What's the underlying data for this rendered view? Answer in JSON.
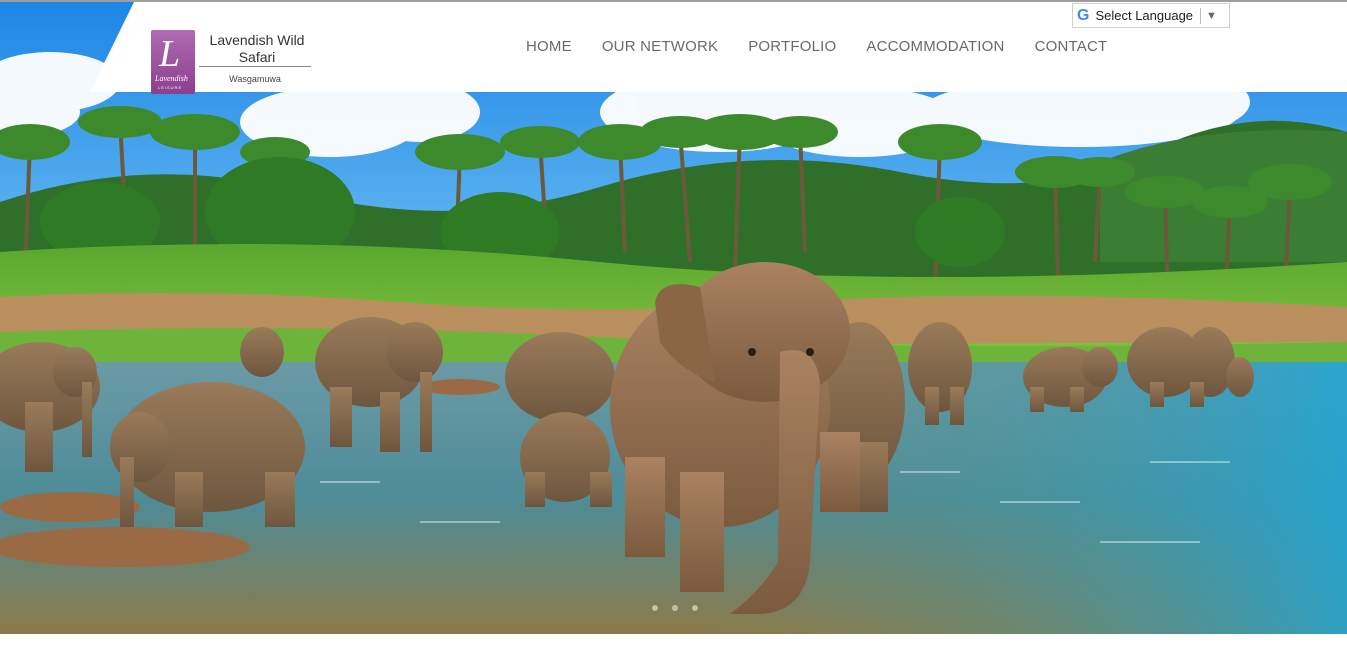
{
  "brand": {
    "name": "Lavendish Wild Safari",
    "location": "Wasgamuwa",
    "logo_letter": "L",
    "logo_line1": "Lavendish",
    "logo_line2": "LEISURE"
  },
  "nav": {
    "items": [
      {
        "label": "HOME"
      },
      {
        "label": "OUR NETWORK"
      },
      {
        "label": "PORTFOLIO"
      },
      {
        "label": "ACCOMMODATION"
      },
      {
        "label": "CONTACT"
      }
    ]
  },
  "translate": {
    "label": "Select Language",
    "arrow": "▼",
    "icon": "G"
  },
  "hero": {
    "image": "elephants-bathing-in-river-photo",
    "slides": 3
  },
  "colors": {
    "sky": "#2f8fe0",
    "brand_purple": "#9b4f9e",
    "nav_text": "#6a6a6a"
  }
}
